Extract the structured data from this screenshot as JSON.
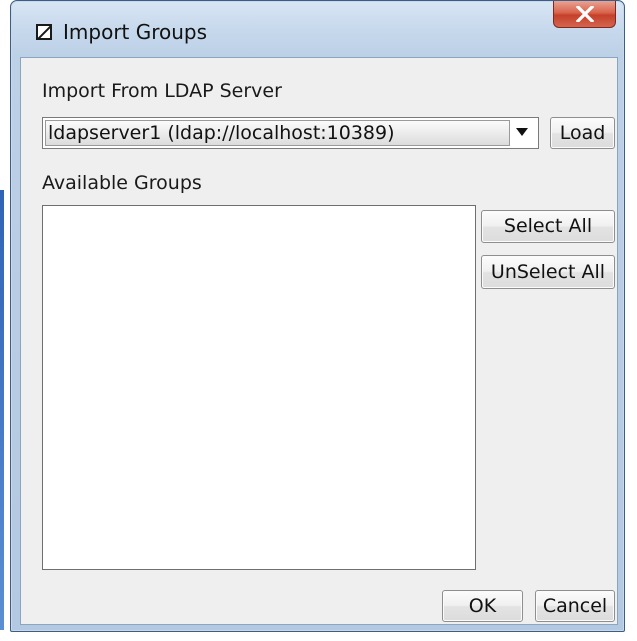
{
  "window": {
    "title": "Import Groups",
    "close_label": "X"
  },
  "ldap_section": {
    "label": "Import From LDAP Server",
    "server_select_value": "ldapserver1 (ldap://localhost:10389)",
    "load_label": "Load"
  },
  "groups_section": {
    "label": "Available Groups",
    "items": [],
    "select_all_label": "Select All",
    "unselect_all_label": "UnSelect All"
  },
  "footer": {
    "ok_label": "OK",
    "cancel_label": "Cancel"
  },
  "colors": {
    "title_bar": "#c6d8ec",
    "close_button": "#d8634b",
    "dialog_background": "#efefef"
  },
  "icons": {
    "window": "window-icon",
    "close": "close-icon",
    "dropdown": "chevron-down-icon"
  }
}
